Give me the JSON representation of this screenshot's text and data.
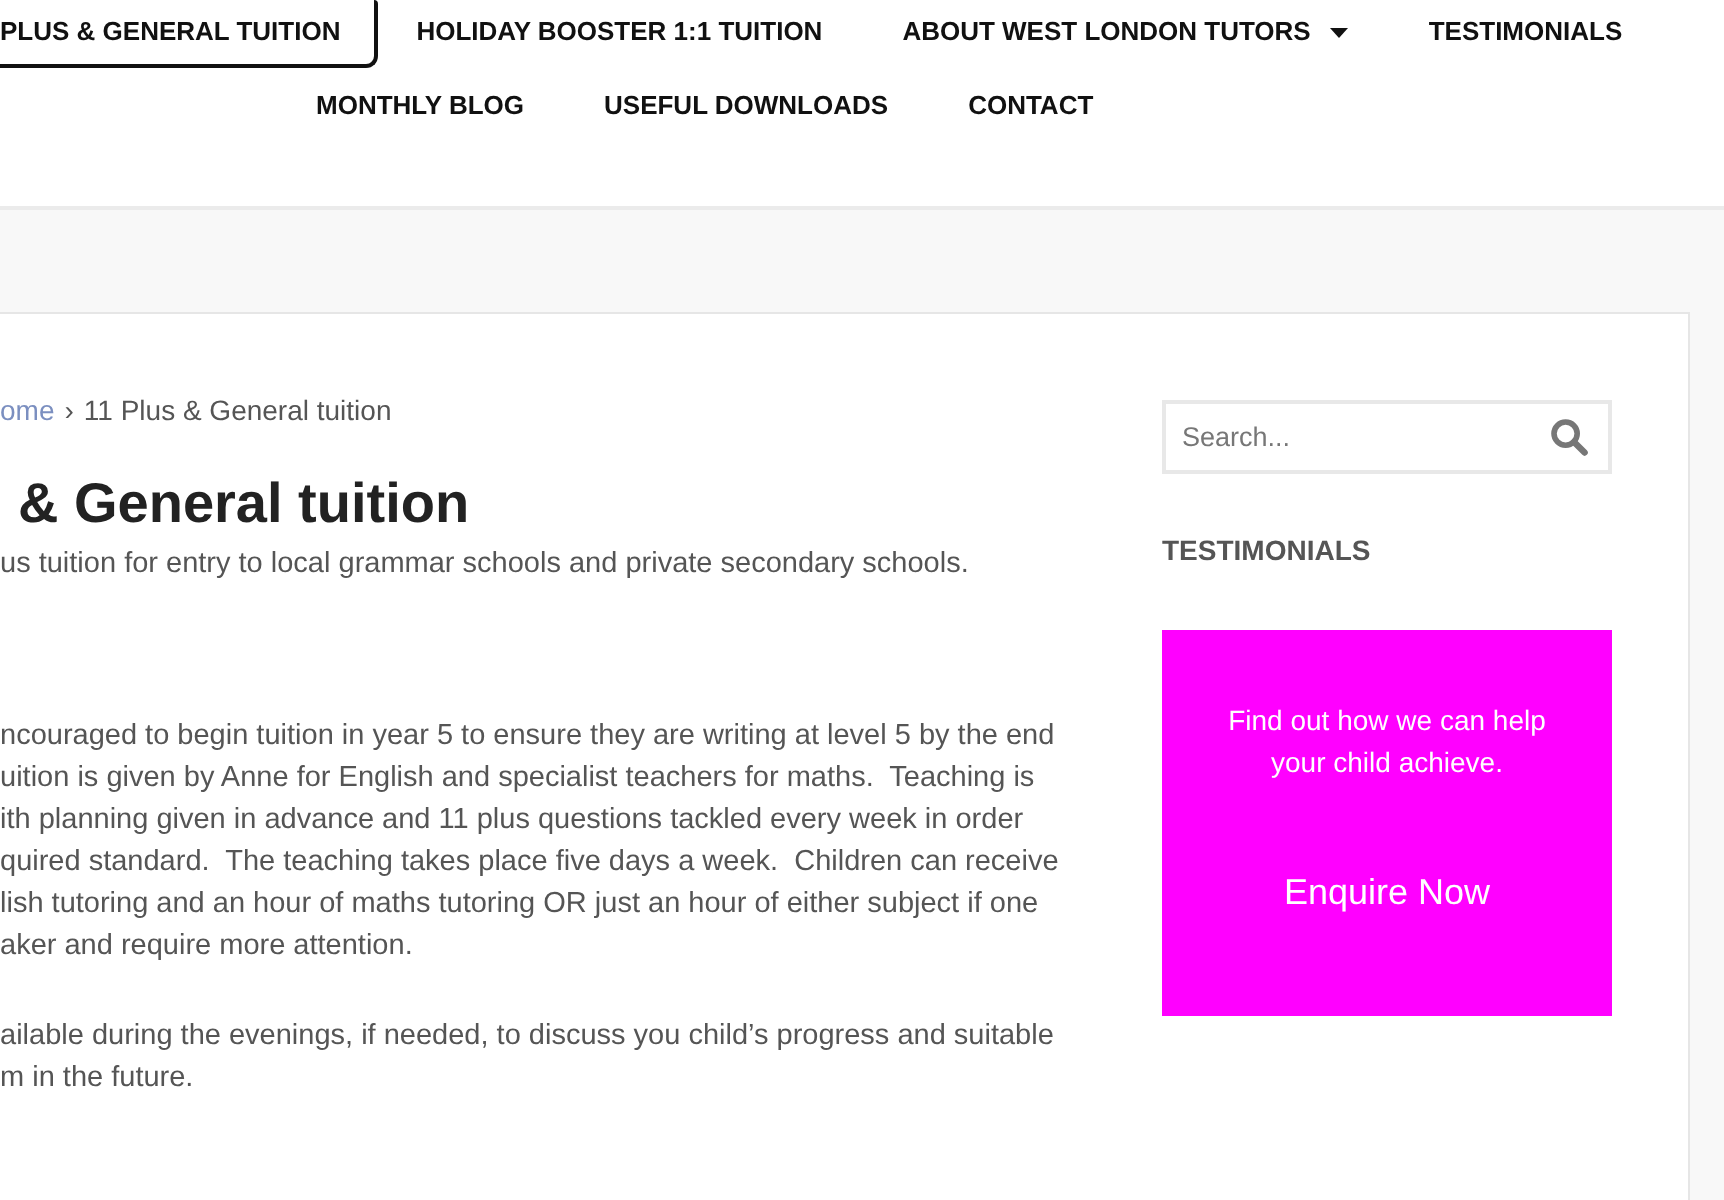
{
  "nav": {
    "rows": [
      [
        {
          "label": "PLUS & GENERAL TUITION",
          "selected": true
        },
        {
          "label": "HOLIDAY BOOSTER 1:1 TUITION",
          "selected": false
        },
        {
          "label": "ABOUT WEST LONDON TUTORS",
          "selected": false,
          "dropdown": true
        },
        {
          "label": "TESTIMONIALS",
          "selected": false
        }
      ],
      [
        {
          "label": "MONTHLY BLOG",
          "selected": false
        },
        {
          "label": "USEFUL DOWNLOADS",
          "selected": false
        },
        {
          "label": "CONTACT",
          "selected": false
        }
      ]
    ]
  },
  "breadcrumb": {
    "link": "ome",
    "separator": "›",
    "current": "11 Plus & General tuition"
  },
  "page": {
    "title": "& General tuition",
    "subtitle": "us tuition for entry to local grammar schools and private secondary schools.",
    "paragraphs": [
      {
        "lines": [
          "ncouraged to begin tuition in year 5 to ensure they are writing at level 5 by the end",
          "uition is given by Anne for English and specialist teachers for maths.  Teaching is",
          "ith planning given in advance and 11 plus questions tackled every week in order",
          "quired standard.  The teaching takes place five days a week.  Children can receive",
          "lish tutoring and an hour of maths tutoring OR just an hour of either subject if one",
          "aker and require more attention."
        ]
      },
      {
        "lines": [
          "ailable during the evenings, if needed, to discuss you child’s progress and suitable",
          "m in the future."
        ]
      }
    ]
  },
  "sidebar": {
    "search": {
      "placeholder": "Search..."
    },
    "widget_title": "TESTIMONIALS",
    "promo": {
      "text": "Find out how we can help your child achieve.",
      "link": "Enquire Now"
    }
  }
}
